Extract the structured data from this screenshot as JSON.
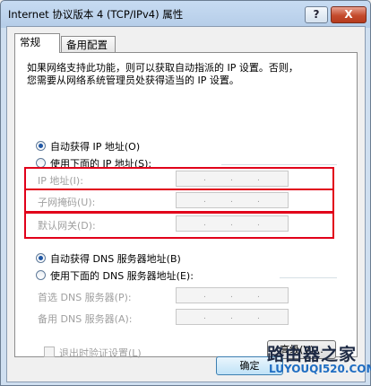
{
  "window": {
    "title": "Internet 协议版本 4 (TCP/IPv4) 属性",
    "help": "?",
    "close": "X"
  },
  "tabs": [
    "常规",
    "备用配置"
  ],
  "description": [
    "如果网络支持此功能，则可以获取自动指派的 IP 设置。否则，",
    "您需要从网络系统管理员处获得适当的 IP 设置。"
  ],
  "ip": {
    "auto_label": "自动获得 IP 地址(O)",
    "manual_label": "使用下面的 IP 地址(S):",
    "mode": "auto",
    "fields": [
      {
        "label": "IP 地址(I):"
      },
      {
        "label": "子网掩码(U):"
      },
      {
        "label": "默认网关(D):"
      }
    ]
  },
  "dns": {
    "auto_label": "自动获得 DNS 服务器地址(B)",
    "manual_label": "使用下面的 DNS 服务器地址(E):",
    "mode": "auto",
    "fields": [
      {
        "label": "首选 DNS 服务器(P):"
      },
      {
        "label": "备用 DNS 服务器(A):"
      }
    ]
  },
  "validate_on_exit": {
    "label": "退出时验证设置(L)",
    "checked": false,
    "enabled": false
  },
  "buttons": {
    "advanced": "高级(V)...",
    "ok": "确定"
  },
  "ip_separator": ".",
  "watermark": {
    "line1": "路由器之家",
    "line2": "LUYOUQI520.COM"
  },
  "colors": {
    "highlight": "#e1001a",
    "title_bar": "#c7dbf2",
    "close_button": "#c44b2d"
  }
}
